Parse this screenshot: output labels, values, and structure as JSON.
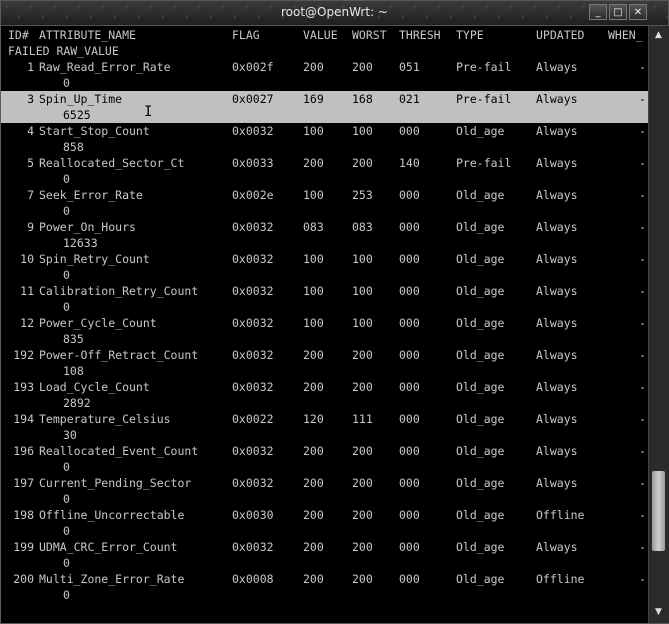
{
  "window": {
    "title": "root@OpenWrt: ~",
    "minimize_glyph": "_",
    "maximize_glyph": "□",
    "close_glyph": "✕"
  },
  "header": {
    "id": "ID#",
    "name": "ATTRIBUTE_NAME",
    "flag": "FLAG",
    "value": "VALUE",
    "worst": "WORST",
    "thresh": "THRESH",
    "type": "TYPE",
    "updated": "UPDATED",
    "when": "WHEN_",
    "line2": "FAILED RAW_VALUE"
  },
  "rows": [
    {
      "id": "1",
      "name": "Raw_Read_Error_Rate",
      "flag": "0x002f",
      "value": "200",
      "worst": "200",
      "thresh": "051",
      "type": "Pre-fail",
      "updated": "Always",
      "when": "-",
      "raw": "0"
    },
    {
      "id": "3",
      "name": "Spin_Up_Time",
      "flag": "0x0027",
      "value": "169",
      "worst": "168",
      "thresh": "021",
      "type": "Pre-fail",
      "updated": "Always",
      "when": "-",
      "raw": "6525"
    },
    {
      "id": "4",
      "name": "Start_Stop_Count",
      "flag": "0x0032",
      "value": "100",
      "worst": "100",
      "thresh": "000",
      "type": "Old_age",
      "updated": "Always",
      "when": "-",
      "raw": "858"
    },
    {
      "id": "5",
      "name": "Reallocated_Sector_Ct",
      "flag": "0x0033",
      "value": "200",
      "worst": "200",
      "thresh": "140",
      "type": "Pre-fail",
      "updated": "Always",
      "when": "-",
      "raw": "0"
    },
    {
      "id": "7",
      "name": "Seek_Error_Rate",
      "flag": "0x002e",
      "value": "100",
      "worst": "253",
      "thresh": "000",
      "type": "Old_age",
      "updated": "Always",
      "when": "-",
      "raw": "0"
    },
    {
      "id": "9",
      "name": "Power_On_Hours",
      "flag": "0x0032",
      "value": "083",
      "worst": "083",
      "thresh": "000",
      "type": "Old_age",
      "updated": "Always",
      "when": "-",
      "raw": "12633"
    },
    {
      "id": "10",
      "name": "Spin_Retry_Count",
      "flag": "0x0032",
      "value": "100",
      "worst": "100",
      "thresh": "000",
      "type": "Old_age",
      "updated": "Always",
      "when": "-",
      "raw": "0"
    },
    {
      "id": "11",
      "name": "Calibration_Retry_Count",
      "flag": "0x0032",
      "value": "100",
      "worst": "100",
      "thresh": "000",
      "type": "Old_age",
      "updated": "Always",
      "when": "-",
      "raw": "0"
    },
    {
      "id": "12",
      "name": "Power_Cycle_Count",
      "flag": "0x0032",
      "value": "100",
      "worst": "100",
      "thresh": "000",
      "type": "Old_age",
      "updated": "Always",
      "when": "-",
      "raw": "835"
    },
    {
      "id": "192",
      "name": "Power-Off_Retract_Count",
      "flag": "0x0032",
      "value": "200",
      "worst": "200",
      "thresh": "000",
      "type": "Old_age",
      "updated": "Always",
      "when": "-",
      "raw": "108"
    },
    {
      "id": "193",
      "name": "Load_Cycle_Count",
      "flag": "0x0032",
      "value": "200",
      "worst": "200",
      "thresh": "000",
      "type": "Old_age",
      "updated": "Always",
      "when": "-",
      "raw": "2892"
    },
    {
      "id": "194",
      "name": "Temperature_Celsius",
      "flag": "0x0022",
      "value": "120",
      "worst": "111",
      "thresh": "000",
      "type": "Old_age",
      "updated": "Always",
      "when": "-",
      "raw": "30"
    },
    {
      "id": "196",
      "name": "Reallocated_Event_Count",
      "flag": "0x0032",
      "value": "200",
      "worst": "200",
      "thresh": "000",
      "type": "Old_age",
      "updated": "Always",
      "when": "-",
      "raw": "0"
    },
    {
      "id": "197",
      "name": "Current_Pending_Sector",
      "flag": "0x0032",
      "value": "200",
      "worst": "200",
      "thresh": "000",
      "type": "Old_age",
      "updated": "Always",
      "when": "-",
      "raw": "0"
    },
    {
      "id": "198",
      "name": "Offline_Uncorrectable",
      "flag": "0x0030",
      "value": "200",
      "worst": "200",
      "thresh": "000",
      "type": "Old_age",
      "updated": "Offline",
      "when": "-",
      "raw": "0"
    },
    {
      "id": "199",
      "name": "UDMA_CRC_Error_Count",
      "flag": "0x0032",
      "value": "200",
      "worst": "200",
      "thresh": "000",
      "type": "Old_age",
      "updated": "Always",
      "when": "-",
      "raw": "0"
    },
    {
      "id": "200",
      "name": "Multi_Zone_Error_Rate",
      "flag": "0x0008",
      "value": "200",
      "worst": "200",
      "thresh": "000",
      "type": "Old_age",
      "updated": "Offline",
      "when": "-",
      "raw": "0"
    }
  ],
  "highlighted_row": "3",
  "cursor_glyph": "I",
  "scrollbar": {
    "up_glyph": "▲",
    "down_glyph": "▼",
    "position_fraction": 0.8
  },
  "colors": {
    "terminal_bg": "#000000",
    "terminal_fg": "#c8c8c8",
    "selection_bg": "#c0c0c0"
  }
}
